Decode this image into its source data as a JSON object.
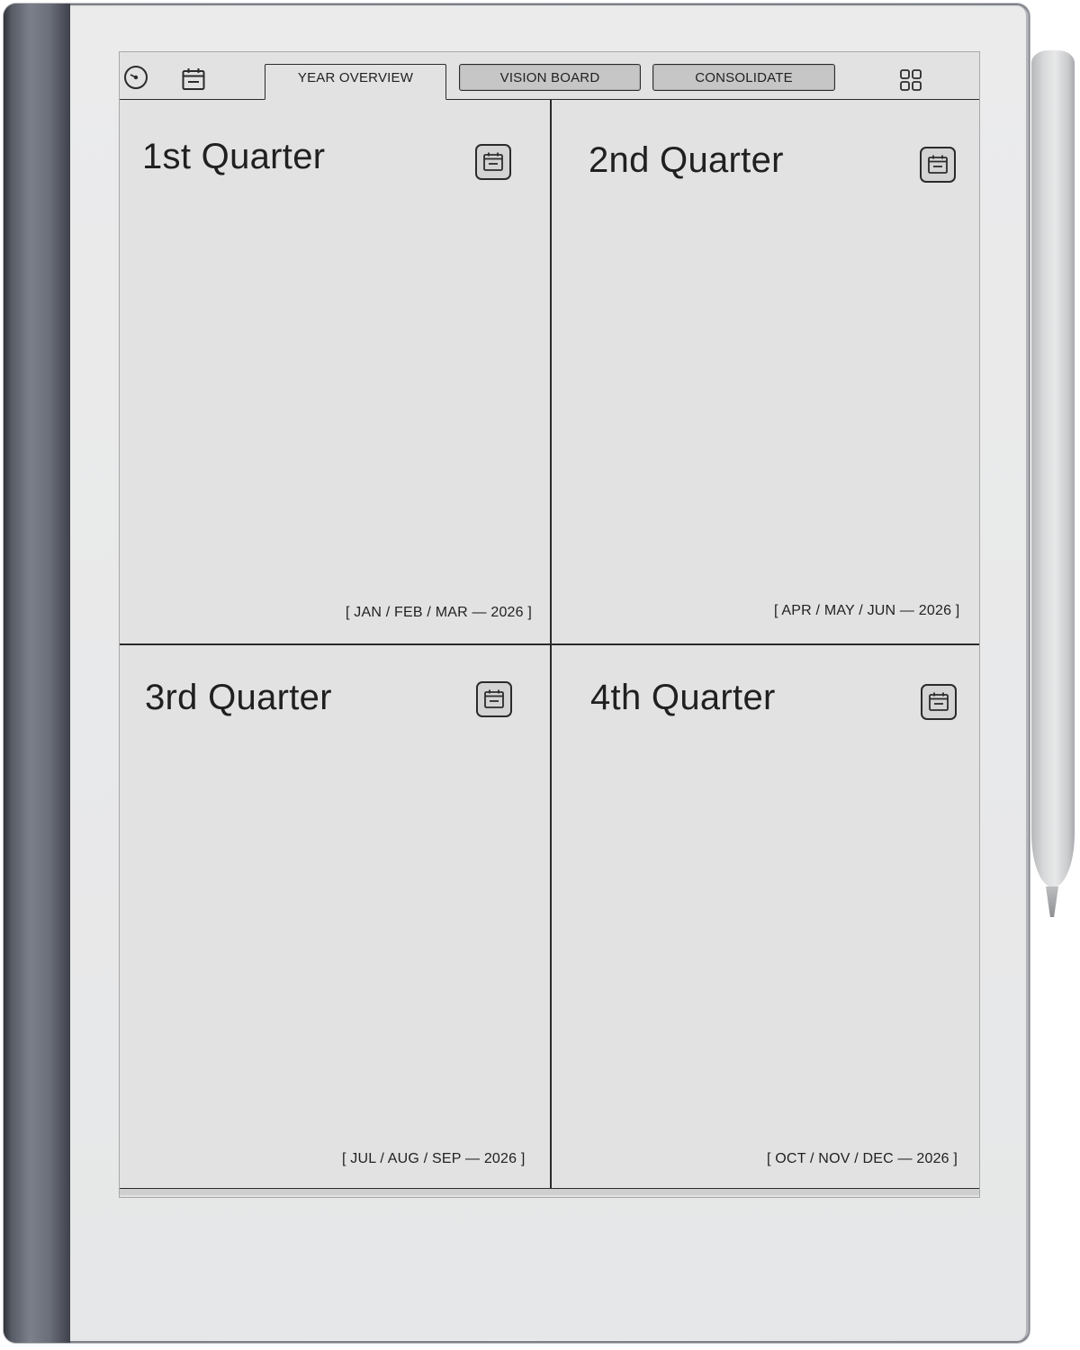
{
  "topbar": {
    "tabs": [
      {
        "label": "YEAR OVERVIEW",
        "active": true
      },
      {
        "label": "VISION BOARD",
        "active": false
      },
      {
        "label": "CONSOLIDATE",
        "active": false
      }
    ],
    "icons": [
      "clock-icon",
      "calendar-icon",
      "grid-icon"
    ]
  },
  "quarters": [
    {
      "title": "1st Quarter",
      "range": "[ JAN / FEB / MAR — 2026 ]"
    },
    {
      "title": "2nd Quarter",
      "range": "[ APR / MAY / JUN — 2026 ]"
    },
    {
      "title": "3rd Quarter",
      "range": "[ JUL / AUG / SEP — 2026 ]"
    },
    {
      "title": "4th Quarter",
      "range": "[ OCT / NOV / DEC — 2026 ]"
    }
  ],
  "colors": {
    "screen": "#e2e2e2",
    "ink": "#2b2b2b",
    "pill": "#c6c6c6"
  }
}
